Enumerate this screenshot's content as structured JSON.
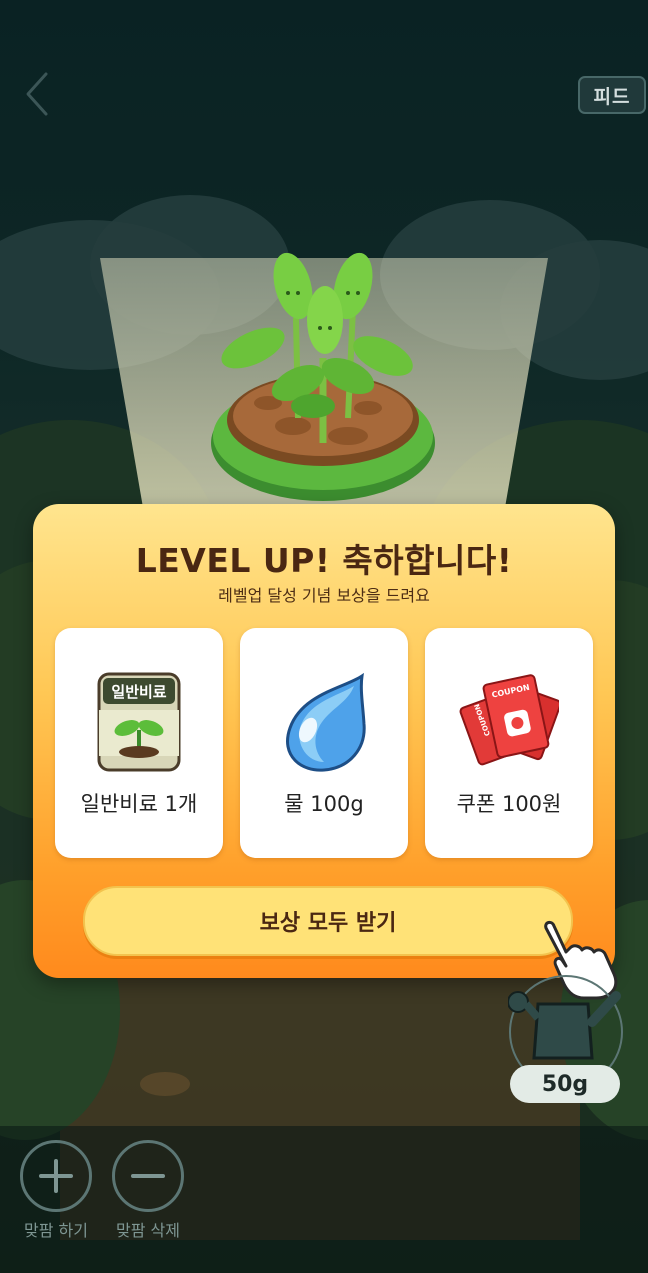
{
  "header": {
    "back_icon": "chevron-left-icon",
    "feed_label": "피드"
  },
  "modal": {
    "title": "LEVEL UP! 축하합니다!",
    "subtitle": "레벨업 달성 기념 보상을 드려요",
    "rewards": [
      {
        "icon": "fertilizer-bag-icon",
        "bag_text": "일반비료",
        "label": "일반비료 1개"
      },
      {
        "icon": "water-drop-icon",
        "label": "물 100g"
      },
      {
        "icon": "coupon-icon",
        "coupon_text": "COUPON",
        "label": "쿠폰 100원"
      }
    ],
    "claim_button": "보상 모두 받기"
  },
  "watering_can": {
    "icon": "watering-can-icon",
    "amount": "50g"
  },
  "bottom_bar": {
    "add": {
      "icon": "plus-icon",
      "label": "맞팜 하기"
    },
    "remove": {
      "icon": "minus-icon",
      "label": "맞팜 삭제"
    }
  },
  "colors": {
    "accent": "#ff9f2a",
    "title_brown": "#4a2712",
    "button_yellow": "#ffe277"
  }
}
